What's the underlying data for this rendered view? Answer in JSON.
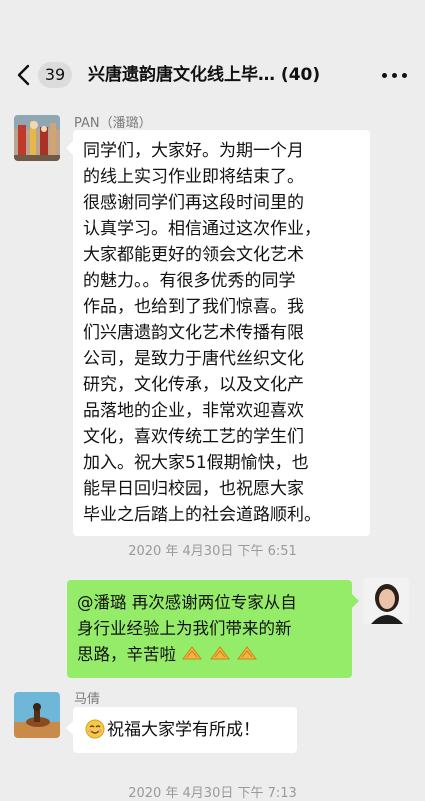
{
  "header": {
    "unread_count": "39",
    "title": "兴唐遗韵唐文化线上毕…",
    "member_count": "(40)"
  },
  "messages": [
    {
      "sender": "PAN（潘璐）",
      "lines": [
        "同学们，大家好。为期一个月",
        "的线上实习作业即将结束了。",
        "很感谢同学们再这段时间里的",
        "认真学习。相信通过这次作业，",
        "大家都能更好的领会文化艺术",
        "的魅力。。有很多优秀的同学",
        "作品，也给到了我们惊喜。我",
        "们兴唐遗韵文化艺术传播有限",
        "公司，是致力于唐代丝织文化",
        "研究，文化传承，以及文化产",
        "品落地的企业，非常欢迎喜欢",
        "文化，喜欢传统工艺的学生们",
        "加入。祝大家51假期愉快，也",
        "能早日回归校园，也祝愿大家",
        "毕业之后踏上的社会道路顺利。"
      ]
    },
    {
      "timestamp": "2020 年 4月30日  下午 6:51"
    },
    {
      "self": true,
      "lines": [
        "@潘璐 再次感谢两位专家从自",
        "身行业经验上为我们带来的新",
        "思路，辛苦啦"
      ]
    },
    {
      "sender": "马倩",
      "text": "祝福大家学有所成！"
    },
    {
      "timestamp": "2020 年 4月30日  下午 7:13"
    }
  ],
  "icons": {
    "back": "chevron-left-icon",
    "more": "more-dots-icon",
    "emoji_smile": "smile-emoji-icon",
    "emoji_clap": "clap-emoji-icon"
  },
  "colors": {
    "background": "#ededed",
    "bubble_self": "#95ec69",
    "bubble_other": "#ffffff"
  }
}
